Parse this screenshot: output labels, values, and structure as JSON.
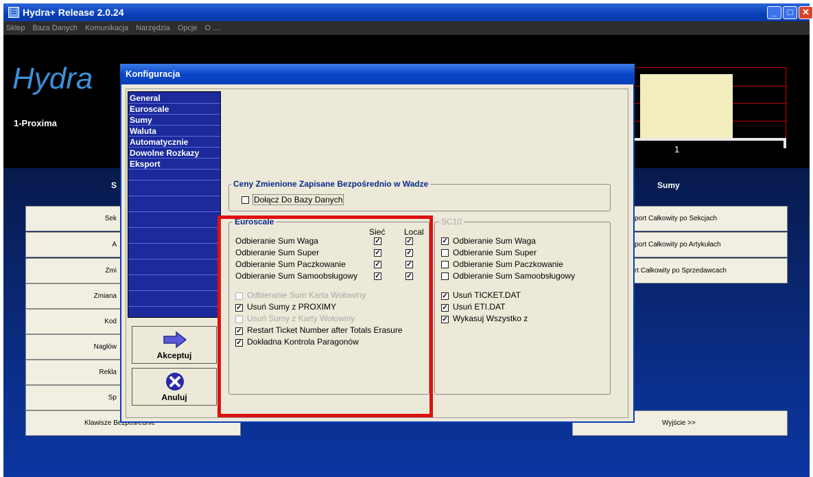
{
  "window": {
    "title": "Hydra+ Release 2.0.24",
    "menu": [
      "Sklep",
      "Baza Danych",
      "Komunikacja",
      "Narzędzia",
      "Opcje",
      "O ...."
    ]
  },
  "main": {
    "logo": "Hydra",
    "store": "1-Proxima",
    "chart_xlabel": "1",
    "left_header_fragment": "S",
    "sumy_header": "Sumy",
    "left_buttons": [
      "Sek",
      "A",
      "Zmi",
      "Zmiana",
      "Kod",
      "Nagłów",
      "Rekla",
      "Sp",
      "Klawisze Bezpośrednie"
    ],
    "right_buttons": [
      "port Całkowity po Sekcjach",
      "port Całkowity po Artykułach",
      "rt Całkowity po Sprzedawcach",
      "Wyjście >>"
    ]
  },
  "dialog": {
    "title": "Konfiguracja",
    "nav": [
      "General",
      "Euroscale",
      "Sumy",
      "Waluta",
      "Automatycznie",
      "Dowolne Rozkazy",
      "Eksport"
    ],
    "accept": "Akceptuj",
    "cancel": "Anuluj",
    "ceny_group": {
      "title": "Ceny Zmienione Zapisane Bezpośrednio w Wadze",
      "option": "Dołącz Do Bazy Danych",
      "checked": false
    },
    "euroscale": {
      "title": "Euroscale",
      "col_siec": "Sieć",
      "col_local": "Local",
      "rows": [
        {
          "label": "Odbieranie Sum Waga",
          "siec": true,
          "local": true
        },
        {
          "label": "Odbieranie Sum Super",
          "siec": true,
          "local": true
        },
        {
          "label": "Odbieranie Sum Paczkowanie",
          "siec": true,
          "local": true
        },
        {
          "label": "Odbieranie Sum Samoobsługowy",
          "siec": true,
          "local": true
        }
      ],
      "options": [
        {
          "label": "Odbieranie Sum Karta Wołowiny",
          "checked": false,
          "disabled": true
        },
        {
          "label": "Usuń Sumy z PROXIMY",
          "checked": true,
          "disabled": false
        },
        {
          "label": "Usuń Sumy z Karty Wołowiny",
          "checked": false,
          "disabled": true
        },
        {
          "label": "Restart Ticket Number after Totals Erasure",
          "checked": true,
          "disabled": false
        },
        {
          "label": "Dokładna Kontrola Paragonów",
          "checked": true,
          "disabled": false
        }
      ]
    },
    "sc10": {
      "title": "SC10",
      "rows": [
        {
          "label": "Odbieranie Sum Waga",
          "checked": true
        },
        {
          "label": "Odbieranie Sum Super",
          "checked": false
        },
        {
          "label": "Odbieranie Sum Paczkowanie",
          "checked": false
        },
        {
          "label": "Odbieranie Sum Samoobsługowy",
          "checked": false
        }
      ],
      "options": [
        {
          "label": "Usuń  TICKET.DAT",
          "checked": true
        },
        {
          "label": "Usuń  ETI.DAT",
          "checked": true
        },
        {
          "label": "Wykasuj Wszystko z",
          "checked": true
        }
      ]
    }
  },
  "colors": {
    "highlight": "#e01010",
    "nav_bg": "#1c2a9c",
    "title_blue": "#0a3fb8"
  }
}
